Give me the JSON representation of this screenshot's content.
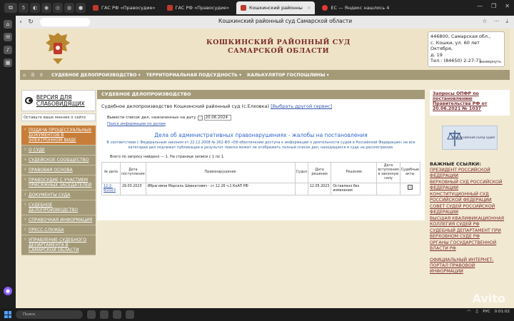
{
  "browser": {
    "tabs": [
      {
        "label": "ГАС РФ «Правосудие»"
      },
      {
        "label": "ГАС РФ «Правосудие»"
      },
      {
        "label": "Кошкинский районны"
      },
      {
        "label": "ЕС — Яндекс нашлось 4"
      }
    ],
    "tab_close": "×",
    "page_title": "Кошкинский районный суд Самарской области",
    "small_tab_count": "5"
  },
  "header": {
    "court_name_line1": "КОШКИНСКИЙ РАЙОННЫЙ СУД",
    "court_name_line2": "САМАРСКОЙ ОБЛАСТИ",
    "address_lines": [
      "446800, Самарская обл.,",
      "с. Кошки, ул. 60 лет Октября,",
      "д. 19",
      "Тел.: (84650) 2-27-71"
    ],
    "expand_label": "развернуть"
  },
  "menu": {
    "items": [
      "СУДЕБНОЕ ДЕЛОПРОИЗВОДСТВО ▾",
      "ТЕРРИТОРИАЛЬНАЯ ПОДСУДНОСТЬ ▾",
      "КАЛЬКУЛЯТОР ГОСПОШЛИНЫ ▾"
    ]
  },
  "left": {
    "vision_label": "ВЕРСИЯ ДЛЯ СЛАБОВИДЯЩИХ",
    "feedback": "Оставьте ваше мнение о сайте",
    "nav": [
      "ПОДАЧА ПРОЦЕССУАЛЬНЫХ ДОКУМЕНТОВ В ЭЛЕКТРОННОМ ВИДЕ",
      "О СУДЕ",
      "СУДЕЙСКОЕ СООБЩЕСТВО",
      "ПРАВОВАЯ ОСНОВА",
      "ПРАВОСУДИЕ С УЧАСТИЕМ ПРИСЯЖНЫХ ЗАСЕДАТЕЛЕЙ",
      "ДОКУМЕНТЫ СУДА",
      "СУДЕБНОЕ ДЕЛОПРОИЗВОДСТВО",
      "СПРАВОЧНАЯ ИНФОРМАЦИЯ",
      "ПРЕСС-СЛУЖБА",
      "УПРАВЛЕНИЕ СУДЕБНОГО ДЕПАРТАМЕНТА В САМАРСКОЙ ОБЛАСТИ"
    ]
  },
  "main": {
    "heading": "СУДЕБНОЕ ДЕЛОПРОИЗВОДСТВО",
    "crumb": "Судебное делопроизводство Кошкинский районный суд (с.Елховка)",
    "crumb_link": "[Выбрать другой сервис]",
    "filter_label": "Вывести список дел, назначенных на дату",
    "filter_date": "20.06.2024",
    "search_link": "Поиск информации по делам",
    "doc_title": "Дела об административных правонарушениях - жалобы на постановления",
    "legal_text": "В соответствии с Федеральным законом от 22.12.2008 № 262-ФЗ «Об обеспечении доступа к информации о деятельности судов в Российской Федерации» не все категории дел подлежат публикации и результат поиска может не отображать полный список дел, находящихся в суде на рассмотрении.",
    "found_text": "Всего по запросу найдено — 1. На странице записи с 1 по 1.",
    "table": {
      "headers": [
        "№ дела",
        "Дата поступления",
        "Правонарушение",
        "Судья",
        "Дата решения",
        "Решение",
        "Дата вступления в законную силу",
        "Судебные акты"
      ],
      "rows": [
        [
          "12-2-8/2023",
          "29.03.2023",
          "Ибрагимов Марсель Шевкатович - ст.12.26 ч.1 КоАП РФ",
          "",
          "12.05.2023",
          "Оставлено без изменения",
          "",
          ""
        ]
      ]
    }
  },
  "right": {
    "notice_link": "Запросы ОПФР по постановлению Правительства РФ от 20.06.2021 № 1037",
    "banner_text": "Всероссийский съезд судей",
    "useful_title": "ВАЖНЫЕ ССЫЛКИ:",
    "useful_links": [
      "ПРЕЗИДЕНТ РОССИЙСКОЙ ФЕДЕРАЦИИ",
      "ВЕРХОВНЫЙ СУД РОССИЙСКОЙ ФЕДЕРАЦИИ",
      "КОНСТИТУЦИОННЫЙ СУД РОССИЙСКОЙ ФЕДЕРАЦИИ",
      "СОВЕТ СУДЕЙ РОССИЙСКОЙ ФЕДЕРАЦИИ",
      "ВЫСШАЯ КВАЛИФИКАЦИОННАЯ КОЛЛЕГИЯ СУДЕЙ РФ",
      "СУДЕБНЫЙ ДЕПАРТАМЕНТ ПРИ ВЕРХОВНОМ СУДЕ РФ",
      "ОРГАНЫ ГОСУДАРСТВЕННОЙ ВЛАСТИ РФ"
    ],
    "more_link": "ОФИЦИАЛЬНЫЙ ИНТЕРНЕТ-ПОРТАЛ ПРАВОВОЙ ИНФОРМАЦИИ"
  },
  "taskbar": {
    "search_placeholder": "Поиск",
    "lang": "РУС",
    "time": "0:01:02"
  },
  "watermark": "Avito",
  "colors": {
    "accent": "#a49a78",
    "active_nav": "#c77e3a",
    "court_red": "#7a2b2b",
    "link_blue": "#3355aa"
  }
}
